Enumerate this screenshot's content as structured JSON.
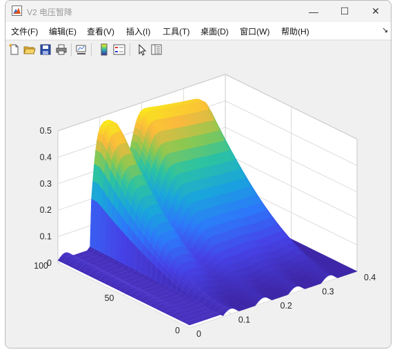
{
  "window": {
    "title": "V2 电压暂降"
  },
  "controls": {
    "minimize": "—",
    "maximize": "☐",
    "close": "✕"
  },
  "menu": [
    {
      "label": "文件(F)"
    },
    {
      "label": "编辑(E)"
    },
    {
      "label": "查看(V)"
    },
    {
      "label": "插入(I)"
    },
    {
      "label": "工具(T)"
    },
    {
      "label": "桌面(D)"
    },
    {
      "label": "窗口(W)"
    },
    {
      "label": "帮助(H)"
    }
  ],
  "menu_overflow": "↘",
  "toolbar": [
    {
      "name": "new-figure-icon"
    },
    {
      "name": "open-file-icon"
    },
    {
      "name": "save-icon"
    },
    {
      "name": "print-icon"
    },
    {
      "name": "link-plot-icon"
    },
    {
      "name": "insert-colorbar-icon"
    },
    {
      "name": "insert-legend-icon"
    },
    {
      "name": "edit-plot-pointer-icon"
    },
    {
      "name": "property-inspector-icon"
    }
  ],
  "chart_data": {
    "type": "surface",
    "colormap": "parula",
    "title": "",
    "xlabel": "",
    "ylabel": "",
    "zlabel": "",
    "x_ticks": [
      "0",
      "0.1",
      "0.2",
      "0.3",
      "0.4"
    ],
    "y_ticks": [
      "0",
      "50",
      "100"
    ],
    "z_ticks": [
      "0",
      "0.1",
      "0.2",
      "0.3",
      "0.4",
      "0.5"
    ],
    "xlim": [
      0,
      0.4
    ],
    "ylim": [
      0,
      100
    ],
    "zlim": [
      0,
      0.5
    ],
    "grid": true,
    "view": "3d-default"
  }
}
